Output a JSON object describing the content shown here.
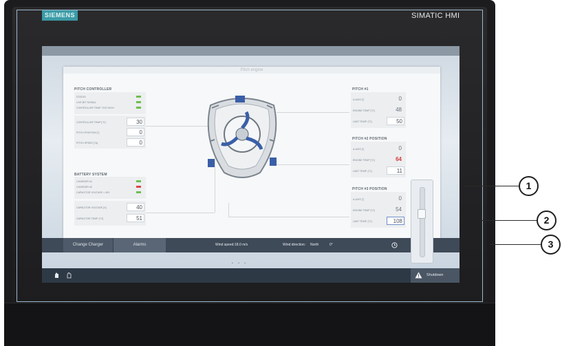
{
  "brand": {
    "logo": "SIEMENS",
    "model": "SIMATIC HMI"
  },
  "screen_title": "Pitch engine",
  "pitch_controller": {
    "title": "PITCH CONTROLLER",
    "status_rows": [
      {
        "label": "STATUS",
        "led": "green"
      },
      {
        "label": "LIVE-BIT SIGNAL",
        "led": "green"
      },
      {
        "label": "CONTROLLER TEMP. TOO HIGH",
        "led": "green"
      }
    ],
    "values": [
      {
        "label": "CONTROLLER TEMP [°C]",
        "value": "30"
      },
      {
        "label": "PITCH POSITION [°]",
        "value": "0"
      },
      {
        "label": "PITCH SPEED [°/s]",
        "value": "0"
      }
    ]
  },
  "battery_system": {
    "title": "BATTERY SYSTEM",
    "status_rows": [
      {
        "label": "CHARGER #1",
        "led": "green"
      },
      {
        "label": "CHARGER #2",
        "led": "red"
      },
      {
        "label": "CAPACITOR VOLTAGE < 40V",
        "led": "green"
      }
    ],
    "values": [
      {
        "label": "CAPACITOR VOLTAGE [V]",
        "value": "40"
      },
      {
        "label": "CAPACITOR TEMP. [°C]",
        "value": "51"
      }
    ]
  },
  "pitch1": {
    "title": "PITCH #1",
    "rows": [
      {
        "label": "A-AXIS [°]",
        "value": "0"
      },
      {
        "label": "ENGINE TEMP [°C]",
        "value": "48"
      },
      {
        "label": "LIMIT TEMP. [°C]",
        "value": "50"
      }
    ]
  },
  "pitch2": {
    "title": "PITCH #2 POSITION",
    "rows": [
      {
        "label": "A-AXIS [°]",
        "value": "0"
      },
      {
        "label": "ENGINE TEMP [°C]",
        "value": "64"
      },
      {
        "label": "LIMIT TEMP. [°C]",
        "value": "11"
      }
    ]
  },
  "pitch3": {
    "title": "PITCH #3 POSITION",
    "rows": [
      {
        "label": "A-AXIS [°]",
        "value": "0"
      },
      {
        "label": "ENGINE TEMP [°C]",
        "value": "54"
      },
      {
        "label": "LIMIT TEMP. [°C]",
        "value": "108"
      }
    ]
  },
  "bottom_bar": {
    "change_charger": "Change Charger",
    "alarms": "Alarms",
    "wind_speed_label": "Wind speed:",
    "wind_speed_value": "18.0 m/s",
    "wind_direction_label": "Wind direction:",
    "wind_direction_value": "North",
    "wind_direction_deg": "0°"
  },
  "page_dots": "• • •",
  "shutdown_label": "Shutdown",
  "callouts": [
    "1",
    "2",
    "3"
  ],
  "colors": {
    "status_ok": "#6dbf4d",
    "status_alarm": "#dd4646",
    "accent_blue": "#3a5fa8"
  },
  "icons": [
    "hand-icon",
    "touch-icon",
    "clock-icon",
    "warning-icon",
    "hub-rotor-image"
  ]
}
